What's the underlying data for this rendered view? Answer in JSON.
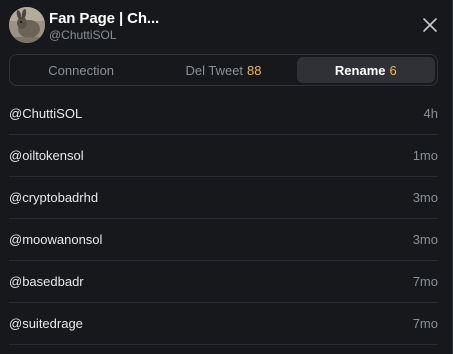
{
  "header": {
    "name": "Fan Page | Ch...",
    "handle": "@ChuttiSOL"
  },
  "tabs": [
    {
      "label": "Connection",
      "count": "",
      "active": false
    },
    {
      "label": "Del Tweet",
      "count": "88",
      "active": false
    },
    {
      "label": "Rename",
      "count": "6",
      "active": true
    }
  ],
  "rows": [
    {
      "handle": "@ChuttiSOL",
      "time": "4h"
    },
    {
      "handle": "@oiltokensol",
      "time": "1mo"
    },
    {
      "handle": "@cryptobadrhd",
      "time": "3mo"
    },
    {
      "handle": "@moowanonsol",
      "time": "3mo"
    },
    {
      "handle": "@basedbadr",
      "time": "7mo"
    },
    {
      "handle": "@suitedrage",
      "time": "7mo"
    }
  ],
  "colors": {
    "background": "#16181c",
    "count_accent": "#f5b84b",
    "active_tab": "#2f3136"
  },
  "icons": {
    "close": "close-icon",
    "avatar": "avatar"
  }
}
